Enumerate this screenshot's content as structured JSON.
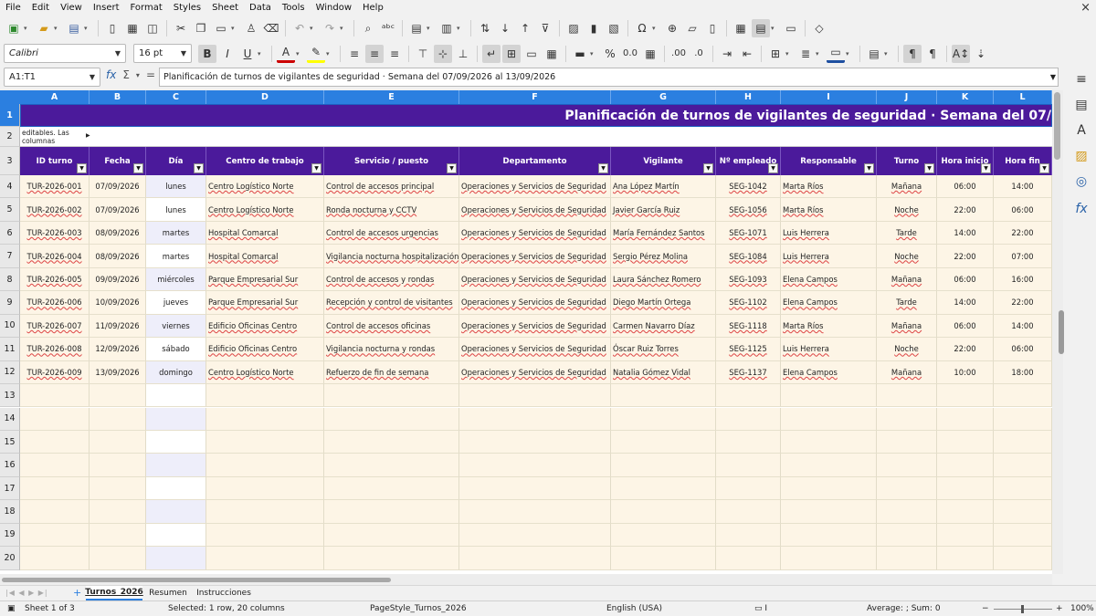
{
  "menu": [
    "File",
    "Edit",
    "View",
    "Insert",
    "Format",
    "Styles",
    "Sheet",
    "Data",
    "Tools",
    "Window",
    "Help"
  ],
  "close_glyph": "×",
  "font_name": "Calibri",
  "font_size": "16 pt",
  "name_box": "A1:T1",
  "formula": "Planificación de turnos de vigilantes de seguridad · Semana del 07/09/2026 al 13/09/2026",
  "columns": [
    "A",
    "B",
    "C",
    "D",
    "E",
    "F",
    "G",
    "H",
    "I",
    "J",
    "K",
    "L"
  ],
  "title_cell": "Planificación de turnos de vigilantes de seguridad · Semana del 07/",
  "note_text": "editables. Las columnas calculadas",
  "headers": [
    "ID turno",
    "Fecha",
    "Día",
    "Centro de trabajo",
    "Servicio / puesto",
    "Departamento",
    "Vigilante",
    "Nº empleado",
    "Responsable",
    "Turno",
    "Hora inicio",
    "Hora fin"
  ],
  "rows": [
    [
      "TUR-2026-001",
      "07/09/2026",
      "lunes",
      "Centro Logístico Norte",
      "Control de accesos principal",
      "Operaciones y Servicios de Seguridad",
      "Ana López Martín",
      "SEG-1042",
      "Marta Ríos",
      "Mañana",
      "06:00",
      "14:00"
    ],
    [
      "TUR-2026-002",
      "07/09/2026",
      "lunes",
      "Centro Logístico Norte",
      "Ronda nocturna y CCTV",
      "Operaciones y Servicios de Seguridad",
      "Javier García Ruiz",
      "SEG-1056",
      "Marta Ríos",
      "Noche",
      "22:00",
      "06:00"
    ],
    [
      "TUR-2026-003",
      "08/09/2026",
      "martes",
      "Hospital Comarcal",
      "Control de accesos urgencias",
      "Operaciones y Servicios de Seguridad",
      "María Fernández Santos",
      "SEG-1071",
      "Luis Herrera",
      "Tarde",
      "14:00",
      "22:00"
    ],
    [
      "TUR-2026-004",
      "08/09/2026",
      "martes",
      "Hospital Comarcal",
      "Vigilancia nocturna hospitalización",
      "Operaciones y Servicios de Seguridad",
      "Sergio Pérez Molina",
      "SEG-1084",
      "Luis Herrera",
      "Noche",
      "22:00",
      "07:00"
    ],
    [
      "TUR-2026-005",
      "09/09/2026",
      "miércoles",
      "Parque Empresarial Sur",
      "Control de accesos y rondas",
      "Operaciones y Servicios de Seguridad",
      "Laura Sánchez Romero",
      "SEG-1093",
      "Elena Campos",
      "Mañana",
      "06:00",
      "16:00"
    ],
    [
      "TUR-2026-006",
      "10/09/2026",
      "jueves",
      "Parque Empresarial Sur",
      "Recepción y control de visitantes",
      "Operaciones y Servicios de Seguridad",
      "Diego Martín Ortega",
      "SEG-1102",
      "Elena Campos",
      "Tarde",
      "14:00",
      "22:00"
    ],
    [
      "TUR-2026-007",
      "11/09/2026",
      "viernes",
      "Edificio Oficinas Centro",
      "Control de accesos oficinas",
      "Operaciones y Servicios de Seguridad",
      "Carmen Navarro Díaz",
      "SEG-1118",
      "Marta Ríos",
      "Mañana",
      "06:00",
      "14:00"
    ],
    [
      "TUR-2026-008",
      "12/09/2026",
      "sábado",
      "Edificio Oficinas Centro",
      "Vigilancia nocturna y rondas",
      "Operaciones y Servicios de Seguridad",
      "Óscar Ruiz Torres",
      "SEG-1125",
      "Luis Herrera",
      "Noche",
      "22:00",
      "06:00"
    ],
    [
      "TUR-2026-009",
      "13/09/2026",
      "domingo",
      "Centro Logístico Norte",
      "Refuerzo de fin de semana",
      "Operaciones y Servicios de Seguridad",
      "Natalia Gómez Vidal",
      "SEG-1137",
      "Elena Campos",
      "Mañana",
      "10:00",
      "18:00"
    ]
  ],
  "row_numbers": [
    "1",
    "2",
    "3",
    "4",
    "5",
    "6",
    "7",
    "8",
    "9",
    "10",
    "11",
    "12",
    "13",
    "14",
    "15",
    "16",
    "17",
    "18",
    "19",
    "20"
  ],
  "sheet_tabs": [
    "Turnos_2026",
    "Resumen",
    "Instrucciones"
  ],
  "active_tab": "Turnos_2026",
  "status": {
    "sheet": "Sheet 1 of 3",
    "selection": "Selected: 1 row, 20 columns",
    "page_style": "PageStyle_Turnos_2026",
    "language": "English (USA)",
    "sum": "Average: ; Sum: 0",
    "zoom": "100%"
  },
  "colors": {
    "header_purple": "#4b1a9b",
    "col_header_blue": "#2b7fe0",
    "cell_cream": "#fdf5e6",
    "day_col": "#eeeefa"
  }
}
